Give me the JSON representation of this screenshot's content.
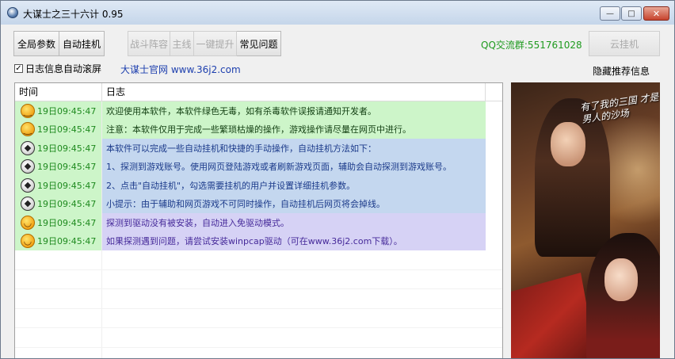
{
  "window": {
    "title": "大谋士之三十六计 0.95",
    "controls": {
      "minimize": "—",
      "maximize": "□",
      "close": "✕"
    }
  },
  "toolbar": {
    "global_params": "全局参数",
    "auto_hangup": "自动挂机",
    "battle_formation": "战斗阵容",
    "main_line": "主线",
    "one_key_upgrade": "一键提升",
    "faq": "常见问题",
    "qq_group": "QQ交流群:551761028",
    "cloud_hangup": "云挂机"
  },
  "options": {
    "auto_scroll_label": "日志信息自动滚屏",
    "auto_scroll_checked": true,
    "official_site": "大谋士官网 www.36j2.com",
    "hide_recommend": "隐藏推荐信息"
  },
  "log_table": {
    "columns": [
      "时间",
      "日志"
    ],
    "rows": [
      {
        "icon": "smile-icon",
        "time": "19日09:45:47",
        "message": "欢迎使用本软件，本软件绿色无毒，如有杀毒软件误报请通知开发者。",
        "tone": "green"
      },
      {
        "icon": "smile-icon",
        "time": "19日09:45:47",
        "message": "注意：本软件仅用于完成一些繁琐枯燥的操作，游戏操作请尽量在网页中进行。",
        "tone": "green"
      },
      {
        "icon": "soccer-ball-icon",
        "time": "19日09:45:47",
        "message": "本软件可以完成一些自动挂机和快捷的手动操作，自动挂机方法如下：",
        "tone": "blue"
      },
      {
        "icon": "soccer-ball-icon",
        "time": "19日09:45:47",
        "message": "1、探测到游戏账号。使用网页登陆游戏或者刷新游戏页面，辅助会自动探测到游戏账号。",
        "tone": "blue"
      },
      {
        "icon": "soccer-ball-icon",
        "time": "19日09:45:47",
        "message": "2、点击\"自动挂机\"，勾选需要挂机的用户并设置详细挂机参数。",
        "tone": "blue"
      },
      {
        "icon": "soccer-ball-icon",
        "time": "19日09:45:47",
        "message": "小提示：由于辅助和网页游戏不可同时操作，自动挂机后网页将会掉线。",
        "tone": "blue"
      },
      {
        "icon": "grin-icon",
        "time": "19日09:45:47",
        "message": "探测到驱动没有被安装，自动进入免驱动模式。",
        "tone": "purple"
      },
      {
        "icon": "grin-icon",
        "time": "19日09:45:47",
        "message": "如果探测遇到问题，请尝试安装winpcap驱动（可在www.36j2.com下载）。",
        "tone": "purple"
      }
    ]
  },
  "ad_banner": {
    "slogan": "有了我的三国 才是男人的沙场"
  },
  "colors": {
    "row_green": "#cdf5c9",
    "row_blue": "#c4d7ef",
    "row_purple": "#d6d2f5",
    "timestamp_green": "#1f8a1f",
    "qq_green": "#1e9a1e",
    "link_blue": "#1d3fae"
  }
}
